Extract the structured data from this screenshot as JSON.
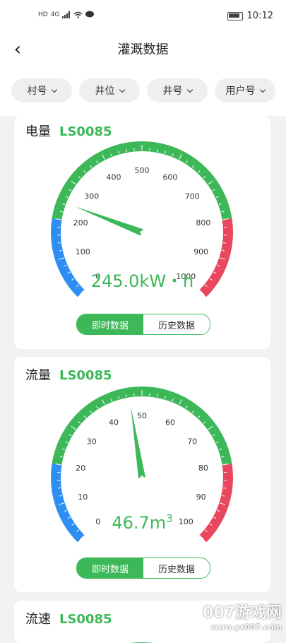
{
  "status": {
    "time": "10:12",
    "left": [
      "HD",
      "4G"
    ]
  },
  "header": {
    "back_icon": "‹",
    "title": "灌溉数据"
  },
  "filters": [
    {
      "label": "村号"
    },
    {
      "label": "井位"
    },
    {
      "label": "井号"
    },
    {
      "label": "用户号"
    }
  ],
  "cards": [
    {
      "label": "电量",
      "id": "LS0085",
      "ticks": [
        "0",
        "100",
        "200",
        "300",
        "400",
        "500",
        "600",
        "700",
        "800",
        "900",
        "1000"
      ],
      "value_text": "245.0kW・h",
      "reading": 245,
      "max": 1000,
      "btn_live": "即时数据",
      "btn_history": "历史数据"
    },
    {
      "label": "流量",
      "id": "LS0085",
      "ticks": [
        "0",
        "10",
        "20",
        "30",
        "40",
        "50",
        "60",
        "70",
        "80",
        "90",
        "100"
      ],
      "value_main": "46.7m",
      "value_sup": "3",
      "reading": 46.7,
      "max": 100,
      "btn_live": "即时数据",
      "btn_history": "历史数据"
    },
    {
      "label": "流速",
      "id": "LS0085"
    }
  ],
  "colors": {
    "green": "#3db858",
    "blue": "#2f8ef3",
    "red": "#e8475d"
  },
  "watermark": {
    "line1": "007游戏网",
    "line2": "www.yx007.com"
  }
}
